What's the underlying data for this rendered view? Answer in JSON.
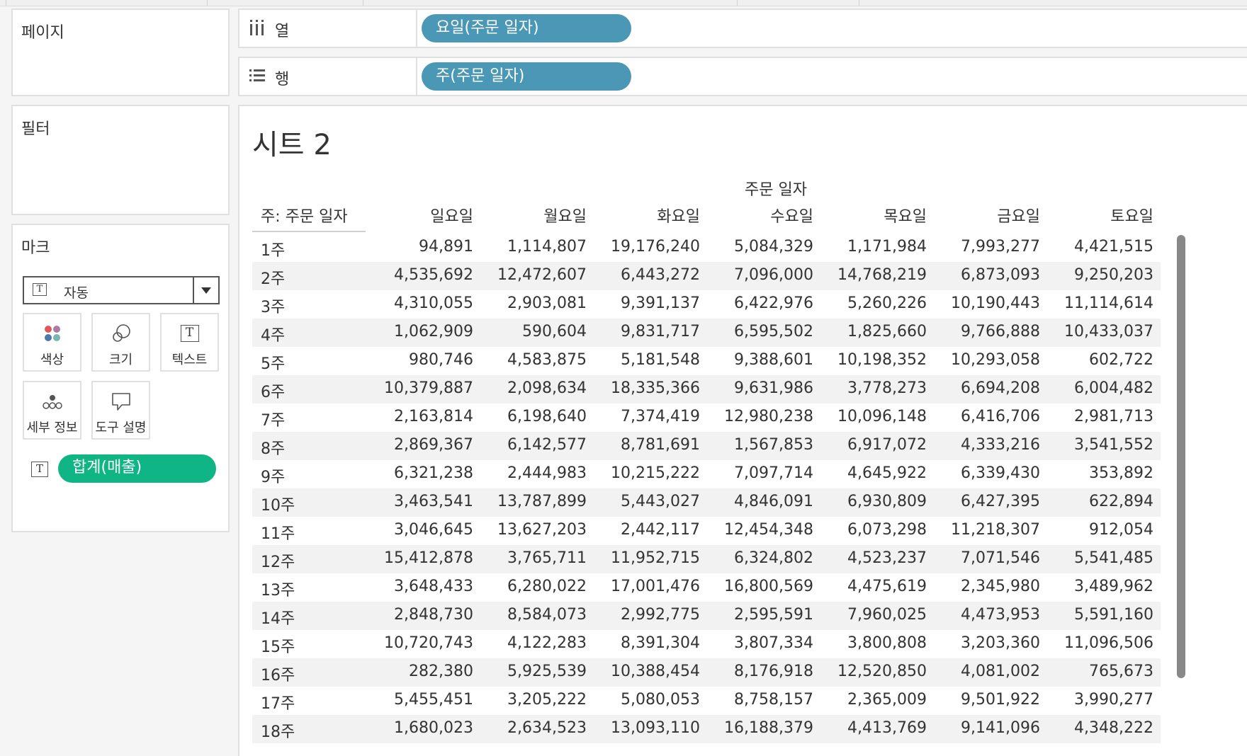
{
  "left_panels": {
    "pages_title": "페이지",
    "filters_title": "필터",
    "marks_title": "마크"
  },
  "marks": {
    "type_value": "자동",
    "buttons": [
      {
        "label": "색상",
        "icon": "color-dots-icon"
      },
      {
        "label": "크기",
        "icon": "size-circles-icon"
      },
      {
        "label": "텍스트",
        "icon": "text-t-icon"
      },
      {
        "label": "세부 정보",
        "icon": "detail-dots-icon"
      },
      {
        "label": "도구 설명",
        "icon": "tooltip-bubble-icon"
      }
    ],
    "measure_pill": "합계(매출)",
    "measure_color": "#0fb585"
  },
  "shelves": {
    "columns_label": "열",
    "columns_pill": "요일(주문 일자)",
    "rows_label": "행",
    "rows_pill": "주(주문 일자)",
    "pill_color": "#4a97b6"
  },
  "sheet": {
    "title": "시트 2",
    "column_group_header": "주문 일자",
    "row_header_title": "주: 주문 일자",
    "columns": [
      "일요일",
      "월요일",
      "화요일",
      "수요일",
      "목요일",
      "금요일",
      "토요일"
    ],
    "rows": [
      {
        "label": "1주",
        "values": [
          "94,891",
          "1,114,807",
          "19,176,240",
          "5,084,329",
          "1,171,984",
          "7,993,277",
          "4,421,515"
        ]
      },
      {
        "label": "2주",
        "values": [
          "4,535,692",
          "12,472,607",
          "6,443,272",
          "7,096,000",
          "14,768,219",
          "6,873,093",
          "9,250,203"
        ]
      },
      {
        "label": "3주",
        "values": [
          "4,310,055",
          "2,903,081",
          "9,391,137",
          "6,422,976",
          "5,260,226",
          "10,190,443",
          "11,114,614"
        ]
      },
      {
        "label": "4주",
        "values": [
          "1,062,909",
          "590,604",
          "9,831,717",
          "6,595,502",
          "1,825,660",
          "9,766,888",
          "10,433,037"
        ]
      },
      {
        "label": "5주",
        "values": [
          "980,746",
          "4,583,875",
          "5,181,548",
          "9,388,601",
          "10,198,352",
          "10,293,058",
          "602,722"
        ]
      },
      {
        "label": "6주",
        "values": [
          "10,379,887",
          "2,098,634",
          "18,335,366",
          "9,631,986",
          "3,778,273",
          "6,694,208",
          "6,004,482"
        ]
      },
      {
        "label": "7주",
        "values": [
          "2,163,814",
          "6,198,640",
          "7,374,419",
          "12,980,238",
          "10,096,148",
          "6,416,706",
          "2,981,713"
        ]
      },
      {
        "label": "8주",
        "values": [
          "2,869,367",
          "6,142,577",
          "8,781,691",
          "1,567,853",
          "6,917,072",
          "4,333,216",
          "3,541,552"
        ]
      },
      {
        "label": "9주",
        "values": [
          "6,321,238",
          "2,444,983",
          "10,215,222",
          "7,097,714",
          "4,645,922",
          "6,339,430",
          "353,892"
        ]
      },
      {
        "label": "10주",
        "values": [
          "3,463,541",
          "13,787,899",
          "5,443,027",
          "4,846,091",
          "6,930,809",
          "6,427,395",
          "622,894"
        ]
      },
      {
        "label": "11주",
        "values": [
          "3,046,645",
          "13,627,203",
          "2,442,117",
          "12,454,348",
          "6,073,298",
          "11,218,307",
          "912,054"
        ]
      },
      {
        "label": "12주",
        "values": [
          "15,412,878",
          "3,765,711",
          "11,952,715",
          "6,324,802",
          "4,523,237",
          "7,071,546",
          "5,541,485"
        ]
      },
      {
        "label": "13주",
        "values": [
          "3,648,433",
          "6,280,022",
          "17,001,476",
          "16,800,569",
          "4,475,619",
          "2,345,980",
          "3,489,962"
        ]
      },
      {
        "label": "14주",
        "values": [
          "2,848,730",
          "8,584,073",
          "2,992,775",
          "2,595,591",
          "7,960,025",
          "4,473,953",
          "5,591,160"
        ]
      },
      {
        "label": "15주",
        "values": [
          "10,720,743",
          "4,122,283",
          "8,391,304",
          "3,807,334",
          "3,800,808",
          "3,203,360",
          "11,096,506"
        ]
      },
      {
        "label": "16주",
        "values": [
          "282,380",
          "5,925,539",
          "10,388,454",
          "8,176,918",
          "12,520,850",
          "4,081,002",
          "765,673"
        ]
      },
      {
        "label": "17주",
        "values": [
          "5,455,451",
          "3,205,222",
          "5,080,053",
          "8,758,157",
          "2,365,009",
          "9,501,922",
          "3,990,277"
        ]
      },
      {
        "label": "18주",
        "values": [
          "1,680,023",
          "2,634,523",
          "13,093,110",
          "16,188,379",
          "4,413,769",
          "9,141,096",
          "4,348,222"
        ]
      }
    ]
  }
}
